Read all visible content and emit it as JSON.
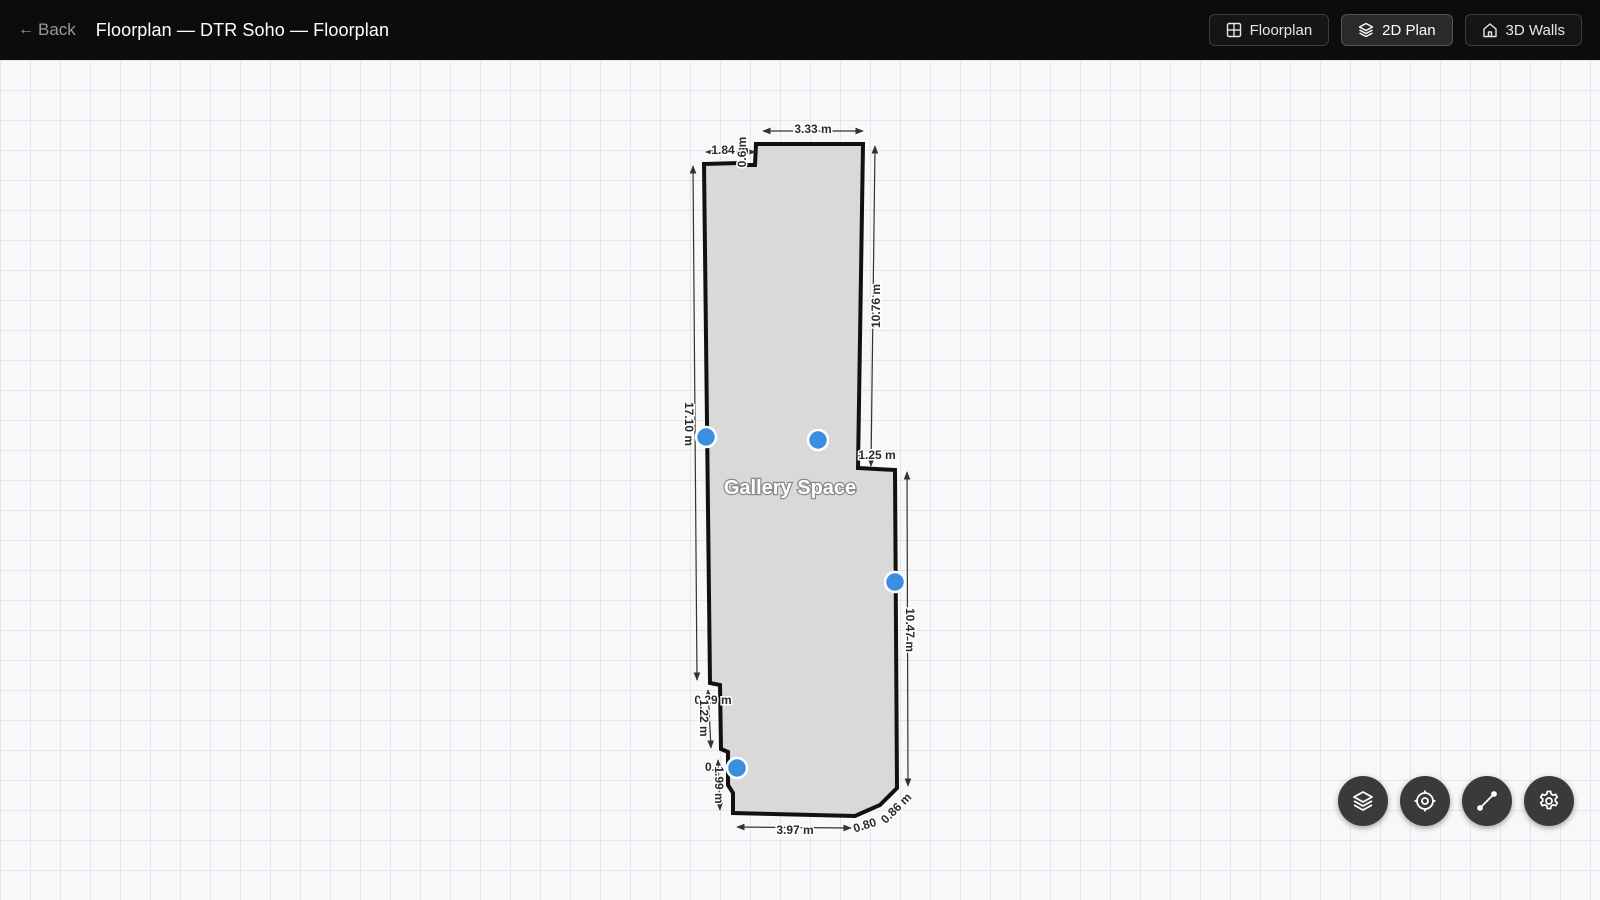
{
  "header": {
    "back_label": "Back",
    "title": "Floorplan — DTR Soho — Floorplan",
    "views": [
      {
        "label": "Floorplan",
        "icon": "grid-icon"
      },
      {
        "label": "2D Plan",
        "icon": "layers-icon",
        "active": true
      },
      {
        "label": "3D Walls",
        "icon": "home-icon"
      }
    ]
  },
  "plan": {
    "room_name": "Gallery Space",
    "dimensions": {
      "top": "3.33 m",
      "top_left": "1.84 m",
      "top_notch": "0.6 m",
      "right_upper": "10.76 m",
      "right_step": "1.25 m",
      "left": "17.10 m",
      "right_lower": "10.47 m",
      "left_step": "0.29 m",
      "left_lower": "1.22 m",
      "left_small": "0.",
      "left_bottom": "1.99 m",
      "bottom": "3.97 m",
      "bottom_right": "0.80",
      "corner": "0.86 m"
    },
    "markers": 4
  },
  "tools": [
    {
      "name": "layers-tool-button",
      "icon": "layers-icon"
    },
    {
      "name": "target-tool-button",
      "icon": "target-icon"
    },
    {
      "name": "measure-tool-button",
      "icon": "ruler-line-icon"
    },
    {
      "name": "settings-tool-button",
      "icon": "gear-icon"
    }
  ],
  "colors": {
    "topbar": "#0c0c0c",
    "room_fill": "#d9d9d9",
    "wall": "#111111",
    "marker": "#3b8fe0",
    "fab": "#3a3a3a"
  }
}
